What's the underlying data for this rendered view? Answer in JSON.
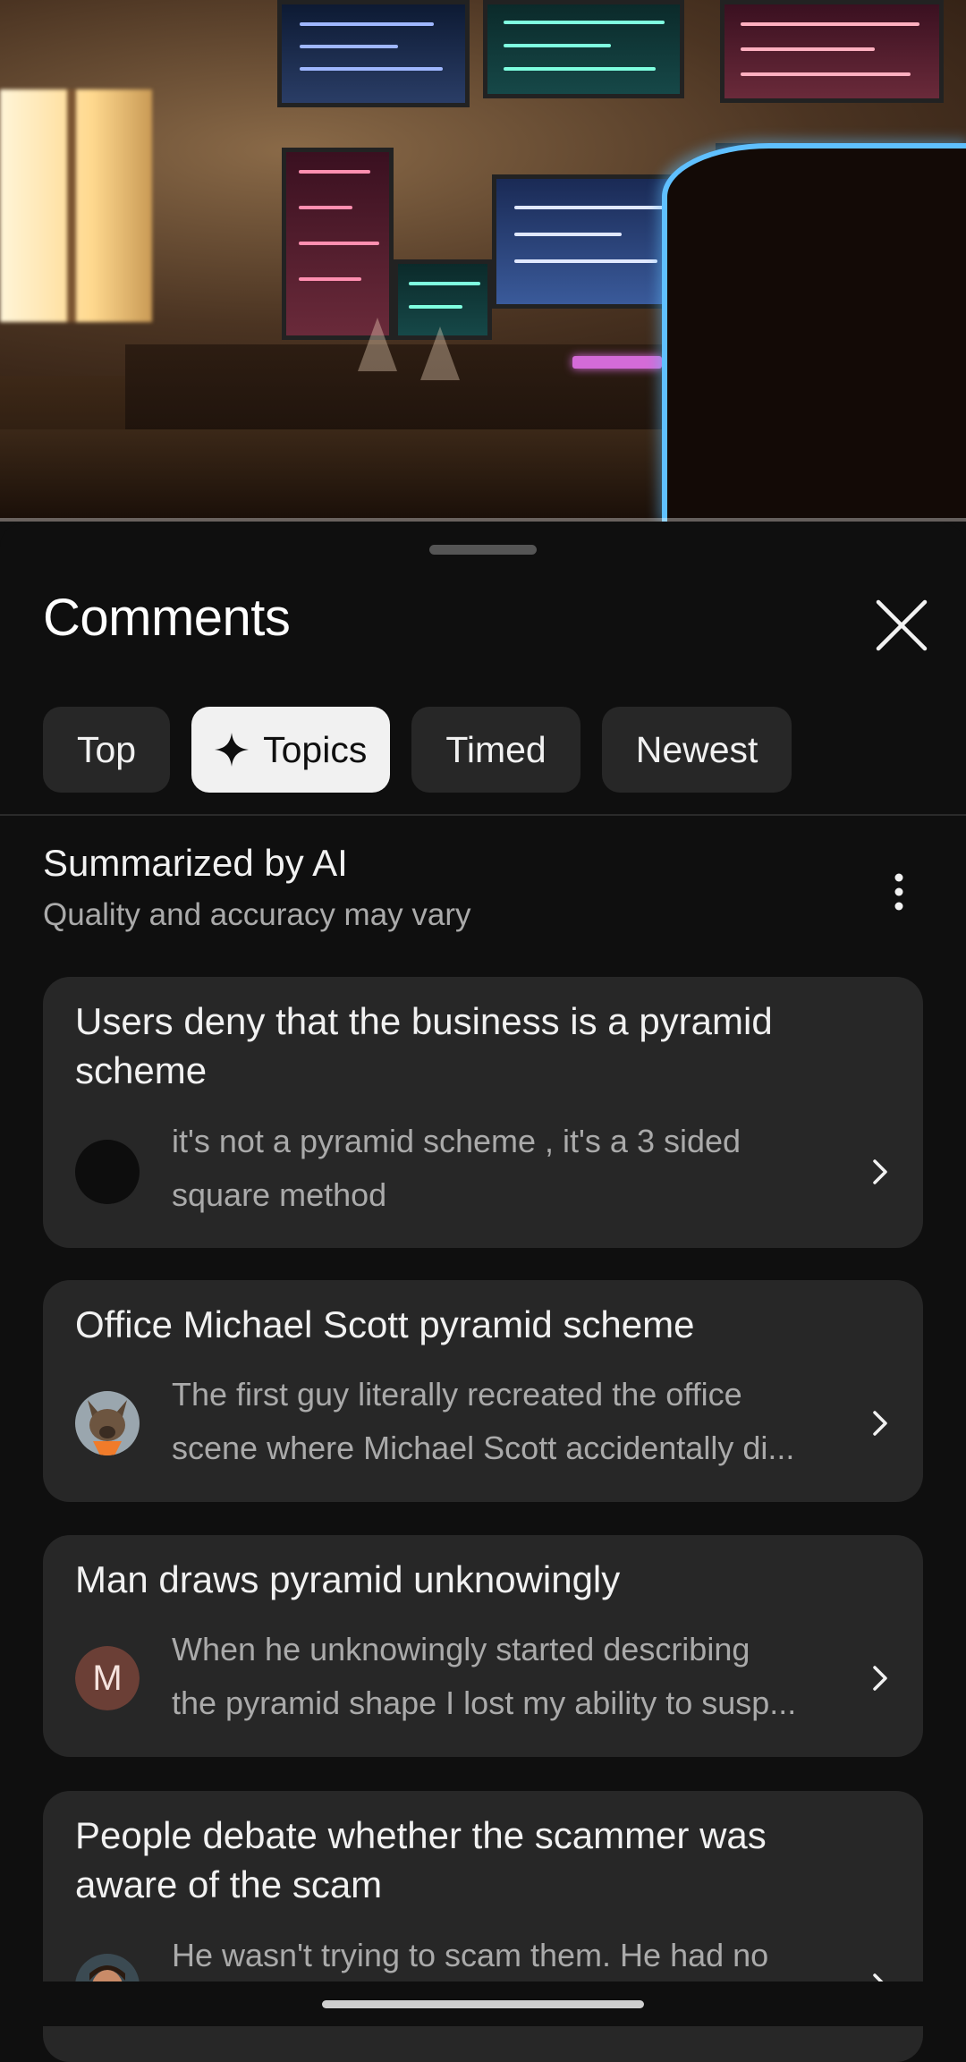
{
  "video": {
    "description_icon": "video-thumbnail"
  },
  "sheet": {
    "title": "Comments",
    "close_icon": "close-icon"
  },
  "chips": [
    {
      "label": "Top",
      "active": false
    },
    {
      "label": "Topics",
      "active": true,
      "icon": "sparkle-icon"
    },
    {
      "label": "Timed",
      "active": false
    },
    {
      "label": "Newest",
      "active": false
    }
  ],
  "summary": {
    "title": "Summarized by AI",
    "subtitle": "Quality and accuracy may vary",
    "menu_icon": "more-vert-icon"
  },
  "topics": [
    {
      "title_lines": [
        "Users deny that the business is a pyramid",
        "scheme"
      ],
      "avatar": "dark-circle",
      "snippet_lines": [
        "it's not a pyramid scheme , it's a 3 sided",
        "square method"
      ]
    },
    {
      "title_lines": [
        "Office Michael Scott pyramid scheme"
      ],
      "avatar": "dog-photo",
      "snippet_lines": [
        "The first guy literally recreated the office",
        "scene where Michael Scott accidentally di..."
      ]
    },
    {
      "title_lines": [
        "Man draws pyramid unknowingly"
      ],
      "avatar": "M",
      "snippet_lines": [
        "When he unknowingly started describing",
        "the pyramid shape I lost my ability to susp..."
      ]
    },
    {
      "title_lines": [
        "People debate whether the scammer was",
        "aware of the scam"
      ],
      "avatar": "man-photo",
      "snippet_lines": [
        "He wasn't trying to scam them.  He had no",
        ""
      ]
    }
  ],
  "colors": {
    "background": "#0f0f0f",
    "card": "#272727",
    "chip": "#272727",
    "chip_active": "#f1f1f1",
    "text_primary": "#f1f1f1",
    "text_secondary": "#aaaaaa",
    "letter_avatar": "#6b3f36"
  }
}
